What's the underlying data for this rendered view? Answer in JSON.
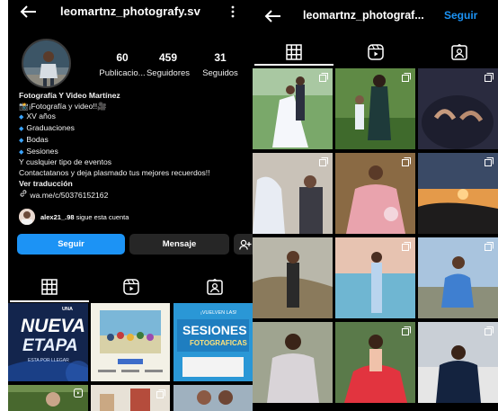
{
  "left": {
    "username": "leomartnz_photografy.sv",
    "stats": [
      {
        "value": "60",
        "label": "Publicacio..."
      },
      {
        "value": "459",
        "label": "Seguidores"
      },
      {
        "value": "31",
        "label": "Seguidos"
      }
    ],
    "bio": {
      "name": "Fotografía Y Video Martínez",
      "tagline": "📸¡Fotografía y video!!🎥",
      "services": [
        "XV años",
        "Graduaciones",
        "Bodas",
        "Sesiones"
      ],
      "line_events": "Y cuslquier tipo de eventos",
      "line_contact": "Contactatanos y deja plasmado tus mejores recuerdos!!",
      "translate": "Ver traducción",
      "link": "wa.me/c/50376152162"
    },
    "followed_by": {
      "user": "alex21_.98",
      "text": "sigue esta cuenta"
    },
    "buttons": {
      "follow": "Seguir",
      "message": "Mensaje"
    },
    "tiles": {
      "tile1_title_small": "UNA",
      "tile1_title": "NUEVA",
      "tile1_title2": "ETAPA",
      "tile1_sub": "ESTA POR LLEGAR",
      "tile3_top": "¡VUELVEN LAS!",
      "tile3_title": "SESIONES",
      "tile3_sub": "FOTOGRAFICAS"
    }
  },
  "right": {
    "username": "leomartnz_photograf...",
    "follow": "Seguir"
  },
  "colors": {
    "background": "#000000",
    "accent": "#1c93f5",
    "secondary_button": "#262626"
  },
  "icons": [
    "back-arrow-icon",
    "more-vertical-icon",
    "grid-icon",
    "reels-icon",
    "tagged-icon",
    "link-icon",
    "add-person-icon",
    "multi-post-icon"
  ]
}
